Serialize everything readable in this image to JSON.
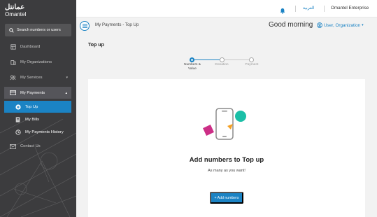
{
  "brand": {
    "logo_ar": "عمانتل",
    "logo_en": "Omantel"
  },
  "sidebar": {
    "search_placeholder": "Search numbers or users",
    "items": [
      {
        "label": "Dashboard",
        "icon": "dashboard-icon"
      },
      {
        "label": "My Organizations",
        "icon": "building-icon"
      },
      {
        "label": "My Services",
        "icon": "people-icon"
      },
      {
        "label": "My Payments",
        "icon": "card-icon"
      },
      {
        "label": "Contact Us",
        "icon": "mail-icon"
      }
    ],
    "payments_sub": [
      {
        "label": "Top Up",
        "icon": "plus-circle-icon",
        "active": true
      },
      {
        "label": "My Bills",
        "icon": "bill-icon"
      },
      {
        "label": "My Payments History",
        "icon": "history-icon"
      }
    ]
  },
  "topbar": {
    "language": "العربية",
    "company": "Omantel Enterprise"
  },
  "header": {
    "breadcrumb": "My Payments - Top Up",
    "greeting": "Good morning",
    "user": "User, Organization"
  },
  "page": {
    "title": "Top up"
  },
  "stepper": {
    "steps": [
      {
        "label": "Numbers & Value",
        "active": true
      },
      {
        "label": "Donation",
        "active": false
      },
      {
        "label": "Payment",
        "active": false
      }
    ]
  },
  "card": {
    "title": "Add numbers to Top up",
    "subtitle": "As many as you want!",
    "button": "+ Add numbers"
  },
  "colors": {
    "accent": "#1b83c4",
    "sidebar": "#3c3c3e",
    "teal": "#1bbfa7",
    "magenta": "#cc2e86",
    "orange": "#f5a023"
  }
}
